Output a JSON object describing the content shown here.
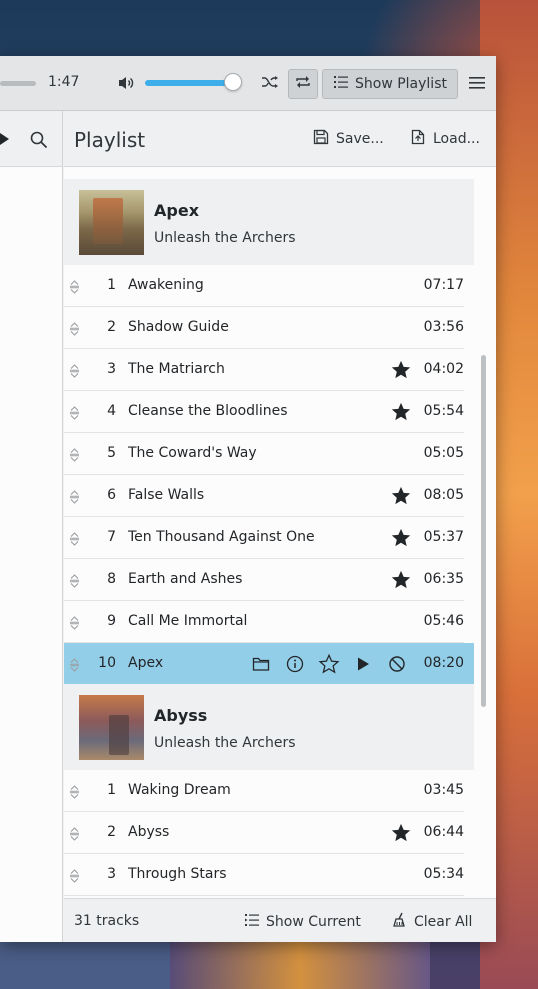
{
  "toolbar": {
    "elapsed_time": "1:47",
    "volume_level": 0.88,
    "show_playlist_label": "Show Playlist"
  },
  "playlist": {
    "title": "Playlist",
    "save_label": "Save...",
    "load_label": "Load...",
    "albums": [
      {
        "name": "Apex",
        "artist": "Unleash the Archers"
      },
      {
        "name": "Abyss",
        "artist": "Unleash the Archers"
      }
    ],
    "apex_tracks": [
      {
        "num": "1",
        "title": "Awakening",
        "duration": "07:17",
        "starred": false
      },
      {
        "num": "2",
        "title": "Shadow Guide",
        "duration": "03:56",
        "starred": false
      },
      {
        "num": "3",
        "title": "The Matriarch",
        "duration": "04:02",
        "starred": true
      },
      {
        "num": "4",
        "title": "Cleanse the Bloodlines",
        "duration": "05:54",
        "starred": true
      },
      {
        "num": "5",
        "title": "The Coward's Way",
        "duration": "05:05",
        "starred": false
      },
      {
        "num": "6",
        "title": "False Walls",
        "duration": "08:05",
        "starred": true
      },
      {
        "num": "7",
        "title": "Ten Thousand Against One",
        "duration": "05:37",
        "starred": true
      },
      {
        "num": "8",
        "title": "Earth and Ashes",
        "duration": "06:35",
        "starred": true
      },
      {
        "num": "9",
        "title": "Call Me Immortal",
        "duration": "05:46",
        "starred": false
      },
      {
        "num": "10",
        "title": "Apex",
        "duration": "08:20",
        "starred": false,
        "active": true
      }
    ],
    "abyss_tracks": [
      {
        "num": "1",
        "title": "Waking Dream",
        "duration": "03:45",
        "starred": false
      },
      {
        "num": "2",
        "title": "Abyss",
        "duration": "06:44",
        "starred": true
      },
      {
        "num": "3",
        "title": "Through Stars",
        "duration": "05:34",
        "starred": false
      }
    ],
    "footer": {
      "track_count": "31 tracks",
      "show_current_label": "Show Current",
      "clear_all_label": "Clear All"
    }
  },
  "colors": {
    "accent": "#3daee9",
    "active_row": "#93cee9",
    "window_bg": "#eff0f1"
  }
}
